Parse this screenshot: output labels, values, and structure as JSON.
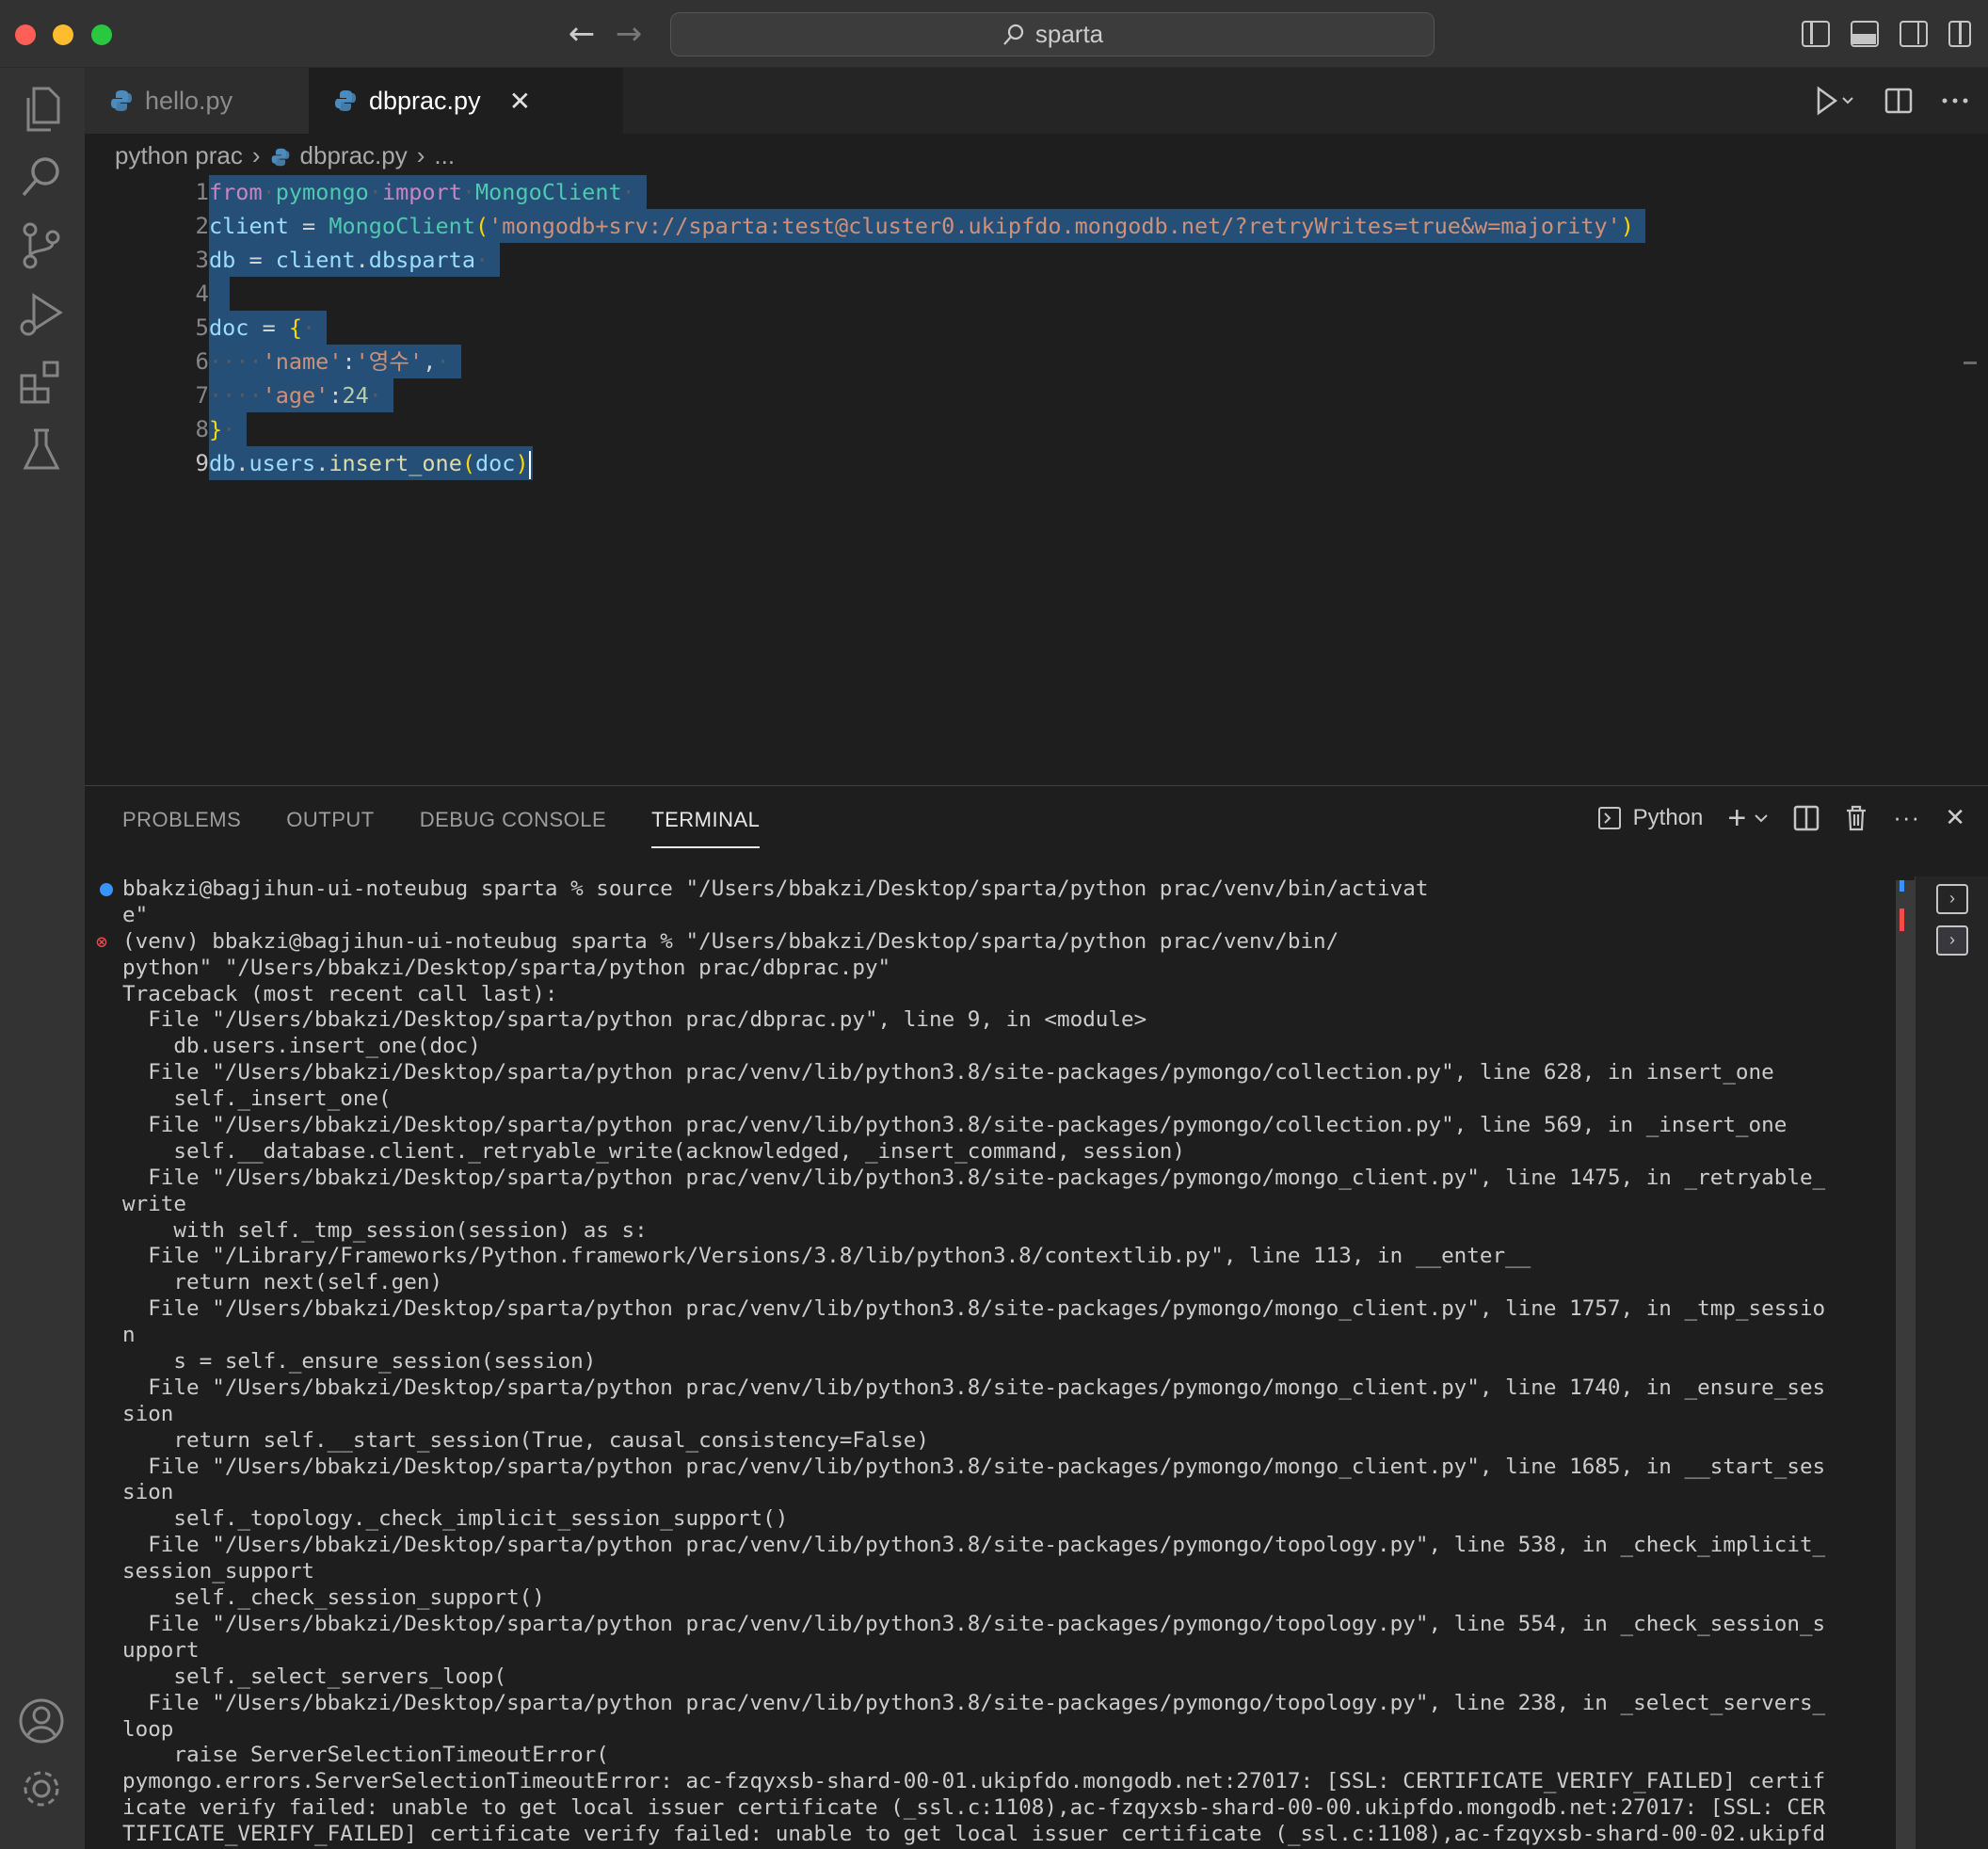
{
  "titlebar": {
    "search_text": "sparta",
    "back_glyph": "←",
    "forward_glyph": "→"
  },
  "tabs": [
    {
      "label": "hello.py"
    },
    {
      "label": "dbprac.py",
      "close": "✕"
    }
  ],
  "breadcrumb": {
    "folder": "python prac",
    "file": "dbprac.py",
    "more": "..."
  },
  "editor": {
    "line_numbers": [
      "1",
      "2",
      "3",
      "4",
      "5",
      "6",
      "7",
      "8",
      "9"
    ],
    "lines": {
      "l1": {
        "from": "from",
        "mod": "pymongo",
        "import": "import",
        "cls": "MongoClient"
      },
      "l2": {
        "var": "client",
        "eq": " = ",
        "cls": "MongoClient",
        "open": "(",
        "str": "'mongodb+srv://sparta:test@cluster0.ukipfdo.mongodb.net/?retryWrites=true&w=majority'",
        "close": ")"
      },
      "l3": {
        "var": "db",
        "eq": " = ",
        "obj": "client",
        "dot": ".",
        "attr": "dbsparta"
      },
      "l5": {
        "var": "doc",
        "eq": " = ",
        "brace": "{"
      },
      "l6": {
        "ws": "····",
        "key": "'name'",
        "colon": ":",
        "val": "'영수'",
        "comma": ","
      },
      "l7": {
        "ws": "····",
        "key": "'age'",
        "colon": ":",
        "val": "24"
      },
      "l8": {
        "brace": "}"
      },
      "l9": {
        "obj": "db",
        "dot1": ".",
        "attr": "users",
        "dot2": ".",
        "fn": "insert_one",
        "open": "(",
        "arg": "doc",
        "close": ")"
      }
    }
  },
  "panel": {
    "tabs": [
      "PROBLEMS",
      "OUTPUT",
      "DEBUG CONSOLE",
      "TERMINAL"
    ],
    "active_tab": "TERMINAL",
    "terminal_profile": "Python",
    "plus": "+",
    "more": "···",
    "close": "✕"
  },
  "terminal": {
    "lines": [
      "bbakzi@bagjihun-ui-noteubug sparta % source \"/Users/bbakzi/Desktop/sparta/python prac/venv/bin/activat",
      "e\"",
      "(venv) bbakzi@bagjihun-ui-noteubug sparta % \"/Users/bbakzi/Desktop/sparta/python prac/venv/bin/",
      "python\" \"/Users/bbakzi/Desktop/sparta/python prac/dbprac.py\"",
      "Traceback (most recent call last):",
      "  File \"/Users/bbakzi/Desktop/sparta/python prac/dbprac.py\", line 9, in <module>",
      "    db.users.insert_one(doc)",
      "  File \"/Users/bbakzi/Desktop/sparta/python prac/venv/lib/python3.8/site-packages/pymongo/collection.py\", line 628, in insert_one",
      "    self._insert_one(",
      "  File \"/Users/bbakzi/Desktop/sparta/python prac/venv/lib/python3.8/site-packages/pymongo/collection.py\", line 569, in _insert_one",
      "    self.__database.client._retryable_write(acknowledged, _insert_command, session)",
      "  File \"/Users/bbakzi/Desktop/sparta/python prac/venv/lib/python3.8/site-packages/pymongo/mongo_client.py\", line 1475, in _retryable_",
      "write",
      "    with self._tmp_session(session) as s:",
      "  File \"/Library/Frameworks/Python.framework/Versions/3.8/lib/python3.8/contextlib.py\", line 113, in __enter__",
      "    return next(self.gen)",
      "  File \"/Users/bbakzi/Desktop/sparta/python prac/venv/lib/python3.8/site-packages/pymongo/mongo_client.py\", line 1757, in _tmp_sessio",
      "n",
      "    s = self._ensure_session(session)",
      "  File \"/Users/bbakzi/Desktop/sparta/python prac/venv/lib/python3.8/site-packages/pymongo/mongo_client.py\", line 1740, in _ensure_ses",
      "sion",
      "    return self.__start_session(True, causal_consistency=False)",
      "  File \"/Users/bbakzi/Desktop/sparta/python prac/venv/lib/python3.8/site-packages/pymongo/mongo_client.py\", line 1685, in __start_ses",
      "sion",
      "    self._topology._check_implicit_session_support()",
      "  File \"/Users/bbakzi/Desktop/sparta/python prac/venv/lib/python3.8/site-packages/pymongo/topology.py\", line 538, in _check_implicit_",
      "session_support",
      "    self._check_session_support()",
      "  File \"/Users/bbakzi/Desktop/sparta/python prac/venv/lib/python3.8/site-packages/pymongo/topology.py\", line 554, in _check_session_s",
      "upport",
      "    self._select_servers_loop(",
      "  File \"/Users/bbakzi/Desktop/sparta/python prac/venv/lib/python3.8/site-packages/pymongo/topology.py\", line 238, in _select_servers_",
      "loop",
      "    raise ServerSelectionTimeoutError(",
      "pymongo.errors.ServerSelectionTimeoutError: ac-fzqyxsb-shard-00-01.ukipfdo.mongodb.net:27017: [SSL: CERTIFICATE_VERIFY_FAILED] certif",
      "icate verify failed: unable to get local issuer certificate (_ssl.c:1108),ac-fzqyxsb-shard-00-00.ukipfdo.mongodb.net:27017: [SSL: CER",
      "TIFICATE_VERIFY_FAILED] certificate verify failed: unable to get local issuer certificate (_ssl.c:1108),ac-fzqyxsb-shard-00-02.ukipfd"
    ]
  },
  "colors": {
    "selection": "#264f78",
    "keyword": "#c586c0",
    "type": "#4ec9b0",
    "variable": "#9cdcfe",
    "string": "#ce9178",
    "number": "#b5cea8",
    "bracket": "#ffd700",
    "function": "#dcdcaa"
  },
  "icons": [
    "explorer-icon",
    "search-icon",
    "source-control-icon",
    "run-debug-icon",
    "extensions-icon",
    "testing-icon",
    "account-icon",
    "settings-gear-icon",
    "python-file-icon",
    "run-icon",
    "split-editor-icon",
    "terminal-icon",
    "trash-icon"
  ]
}
